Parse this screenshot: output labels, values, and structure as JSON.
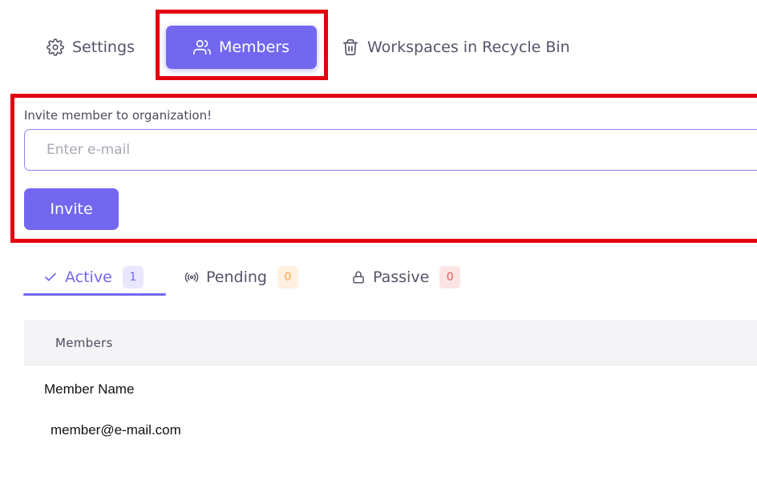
{
  "top_tabs": {
    "settings": {
      "label": "Settings",
      "icon": "gear-icon"
    },
    "members": {
      "label": "Members",
      "icon": "users-icon"
    },
    "recycle_bin": {
      "label": "Workspaces in Recycle Bin",
      "icon": "trash-icon"
    }
  },
  "invite": {
    "label": "Invite member to organization!",
    "placeholder": "Enter e-mail",
    "button_label": "Invite"
  },
  "status_tabs": {
    "active": {
      "label": "Active",
      "count": "1",
      "icon": "check-icon"
    },
    "pending": {
      "label": "Pending",
      "count": "0",
      "icon": "broadcast-icon"
    },
    "passive": {
      "label": "Passive",
      "count": "0",
      "icon": "lock-icon"
    }
  },
  "table": {
    "header": "Members",
    "rows": [
      {
        "name": "Member Name",
        "email": "member@e-mail.com"
      }
    ]
  },
  "colors": {
    "accent": "#7367f0",
    "highlight": "#e3000f",
    "pending": "#ff9f43",
    "passive": "#ea5455"
  }
}
